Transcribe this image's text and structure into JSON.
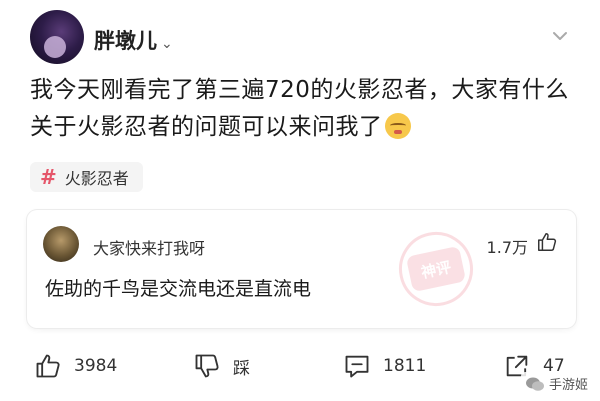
{
  "post": {
    "username": "胖墩儿",
    "username_chevron": "⌄",
    "text_line1": "我今天刚看完了第三遍720的火影忍者，大家有什么",
    "text_line2": "关于火影忍者的问题可以来问我了",
    "tag": "火影忍者"
  },
  "comment": {
    "username": "大家快来打我呀",
    "likes": "1.7万",
    "text": "佐助的千鸟是交流电还是直流电",
    "stamp": "神评"
  },
  "actions": {
    "like_count": "3984",
    "dislike_label": "踩",
    "comment_count": "1811",
    "share_count": "47"
  },
  "watermark": {
    "text": "手游姬"
  },
  "icons": {
    "tag": "hashtag-icon",
    "like": "thumbs-up-icon",
    "dislike": "thumbs-down-icon",
    "comment": "comment-icon",
    "share": "share-icon",
    "more": "chevron-down-icon"
  },
  "colors": {
    "accent": "#e5566a",
    "text": "#1a1a1a"
  }
}
